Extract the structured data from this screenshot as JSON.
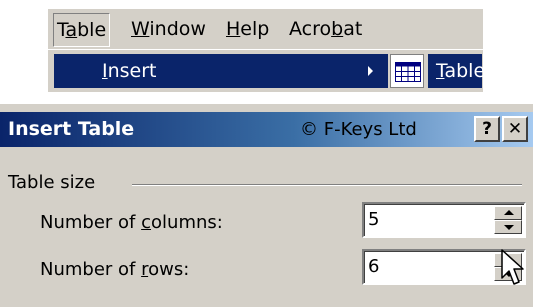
{
  "menubar": {
    "items": [
      {
        "pre": "T",
        "u": "a",
        "post": "ble"
      },
      {
        "pre": "",
        "u": "W",
        "post": "indow"
      },
      {
        "pre": "",
        "u": "H",
        "post": "elp"
      },
      {
        "pre": "Acro",
        "u": "b",
        "post": "at"
      }
    ]
  },
  "submenu": {
    "insert": {
      "pre": "",
      "u": "I",
      "post": "nsert"
    },
    "table": {
      "pre": "",
      "u": "T",
      "post": "able..."
    }
  },
  "dialog": {
    "title": "Insert Table",
    "copyright": "© F-Keys Ltd",
    "help_label": "?",
    "close_label": "✕",
    "group_label": "Table size",
    "columns": {
      "pre": "Number of ",
      "u": "c",
      "post": "olumns:",
      "value": "5"
    },
    "rows": {
      "pre": "Number of ",
      "u": "r",
      "post": "ows:",
      "value": "6"
    }
  }
}
